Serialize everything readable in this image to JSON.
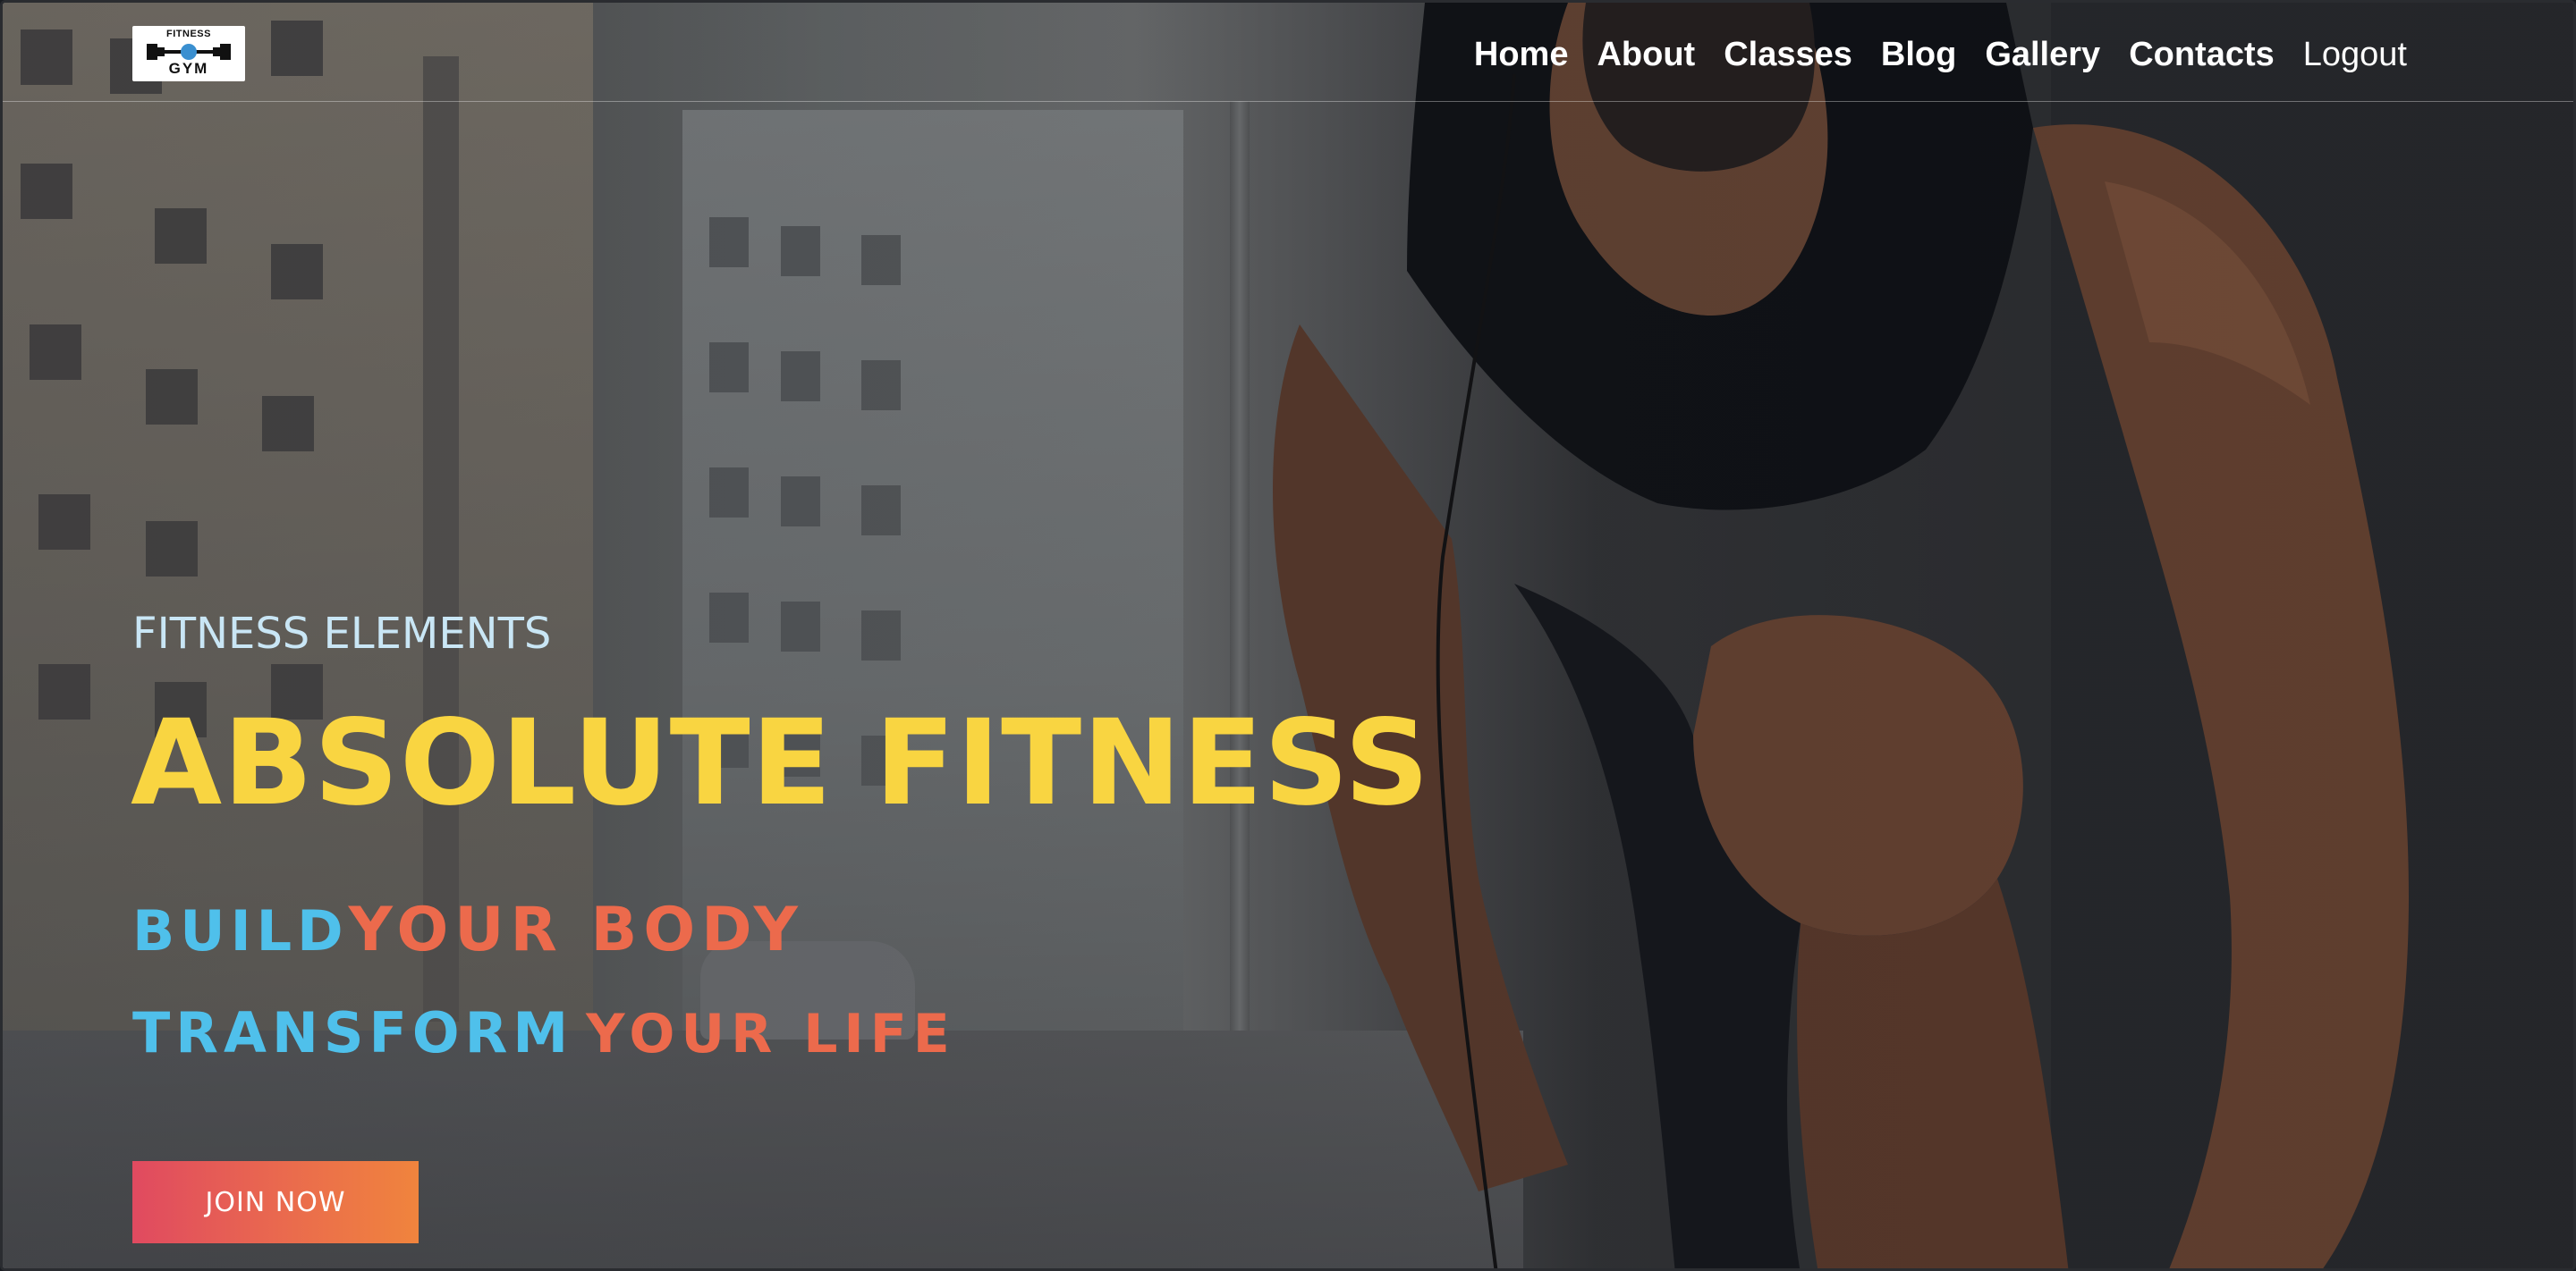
{
  "brand": {
    "logo_top": "FITNESS",
    "logo_bottom": "GYM"
  },
  "nav": {
    "items": [
      {
        "label": "Home"
      },
      {
        "label": "About"
      },
      {
        "label": "Classes"
      },
      {
        "label": "Blog"
      },
      {
        "label": "Gallery"
      },
      {
        "label": "Contacts"
      },
      {
        "label": "Logout"
      }
    ]
  },
  "hero": {
    "eyebrow": "FITNESS ELEMENTS",
    "title": "ABSOLUTE FITNESS",
    "line1_a": "BUILD",
    "line1_b": "YOUR BODY",
    "line2_a": "TRANSFORM",
    "line2_b": "YOUR LIFE",
    "cta_label": "JOIN NOW"
  },
  "colors": {
    "title": "#f9d541",
    "accent_blue": "#4fc0eb",
    "accent_red": "#ec6a4c",
    "eyebrow": "#c9e6f5"
  }
}
